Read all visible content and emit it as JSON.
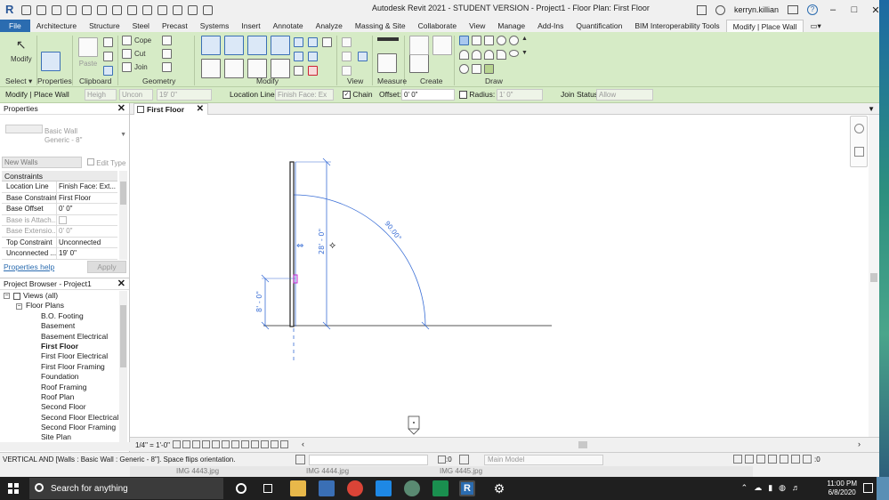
{
  "title_bar": {
    "title": "Autodesk Revit 2021 - STUDENT VERSION - Project1 - Floor Plan: First Floor",
    "user": "kerryn.killian"
  },
  "ribbon_tabs": [
    "File",
    "Architecture",
    "Structure",
    "Steel",
    "Precast",
    "Systems",
    "Insert",
    "Annotate",
    "Analyze",
    "Massing & Site",
    "Collaborate",
    "View",
    "Manage",
    "Add-Ins",
    "Quantification",
    "BIM Interoperability Tools",
    "Modify | Place Wall"
  ],
  "active_tab": "Modify | Place Wall",
  "ribbon": {
    "modify_label": "Modify",
    "paste_label": "Paste",
    "cope_label": "Cope",
    "cut_label": "Cut",
    "join_label": "Join",
    "panels": [
      "Select",
      "Properties",
      "Clipboard",
      "Geometry",
      "Modify",
      "View",
      "Measure",
      "Create",
      "Draw"
    ]
  },
  "options_bar": {
    "context": "Modify | Place Wall",
    "height_mode": "Heigh",
    "height_constraint": "Uncon",
    "height_value": "19'  0\"",
    "location_line_label": "Location Line:",
    "location_line_value": "Finish Face: Ex",
    "chain_label": "Chain",
    "chain_checked": true,
    "offset_label": "Offset:",
    "offset_value": "0'  0\"",
    "radius_label": "Radius:",
    "radius_value": "1'  0\"",
    "join_status_label": "Join Status:",
    "join_status_value": "Allow"
  },
  "properties": {
    "title": "Properties",
    "type_family": "Basic Wall",
    "type_name": "Generic - 8\"",
    "instance_filter": "New Walls",
    "edit_type": "Edit Type",
    "group": "Constraints",
    "rows": [
      {
        "key": "Location Line",
        "value": "Finish Face: Ext...",
        "dim": false
      },
      {
        "key": "Base Constraint",
        "value": "First Floor",
        "dim": false
      },
      {
        "key": "Base Offset",
        "value": "0'  0\"",
        "dim": false
      },
      {
        "key": "Base is Attach...",
        "value": "",
        "dim": true
      },
      {
        "key": "Base Extensio...",
        "value": "0'  0\"",
        "dim": true
      },
      {
        "key": "Top Constraint",
        "value": "Unconnected",
        "dim": false
      },
      {
        "key": "Unconnected ...",
        "value": "19'  0\"",
        "dim": false
      }
    ],
    "help_link": "Properties help",
    "apply": "Apply"
  },
  "project_browser": {
    "title": "Project Browser - Project1",
    "root": "Views (all)",
    "group": "Floor Plans",
    "items": [
      "B.O. Footing",
      "Basement",
      "Basement Electrical",
      "First Floor",
      "First Floor Electrical",
      "First Floor Framing",
      "Foundation",
      "Roof Framing",
      "Roof Plan",
      "Second Floor",
      "Second Floor Electrical",
      "Second Floor Framing",
      "Site Plan"
    ],
    "active_item": "First Floor"
  },
  "view_tab": {
    "label": "First Floor"
  },
  "canvas": {
    "dim_vertical_tall": "28' - 0\"",
    "dim_vertical_short": "8' - 0\"",
    "dim_angle": "90.00°"
  },
  "view_control": {
    "scale": "1/4\" = 1'-0\""
  },
  "status_bar": {
    "message": "VERTICAL AND [Walls : Basic Wall : Generic - 8\"].  Space flips orientation.",
    "active_count": ":0",
    "model": "Main Model",
    "filter_count": ":0"
  },
  "background_window": {
    "files": [
      "IMG 4443.jpg",
      "IMG 4444.jpg",
      "IMG 4445.jpg"
    ]
  },
  "taskbar": {
    "search_placeholder": "Search for anything",
    "time": "11:00 PM",
    "date": "6/8/2020"
  },
  "colors": {
    "ribbon_green": "#d6ebc6",
    "file_tab_blue": "#2b6cb0",
    "dimension_blue": "#3b6fd6",
    "taskbar": "#1f1f1f"
  }
}
